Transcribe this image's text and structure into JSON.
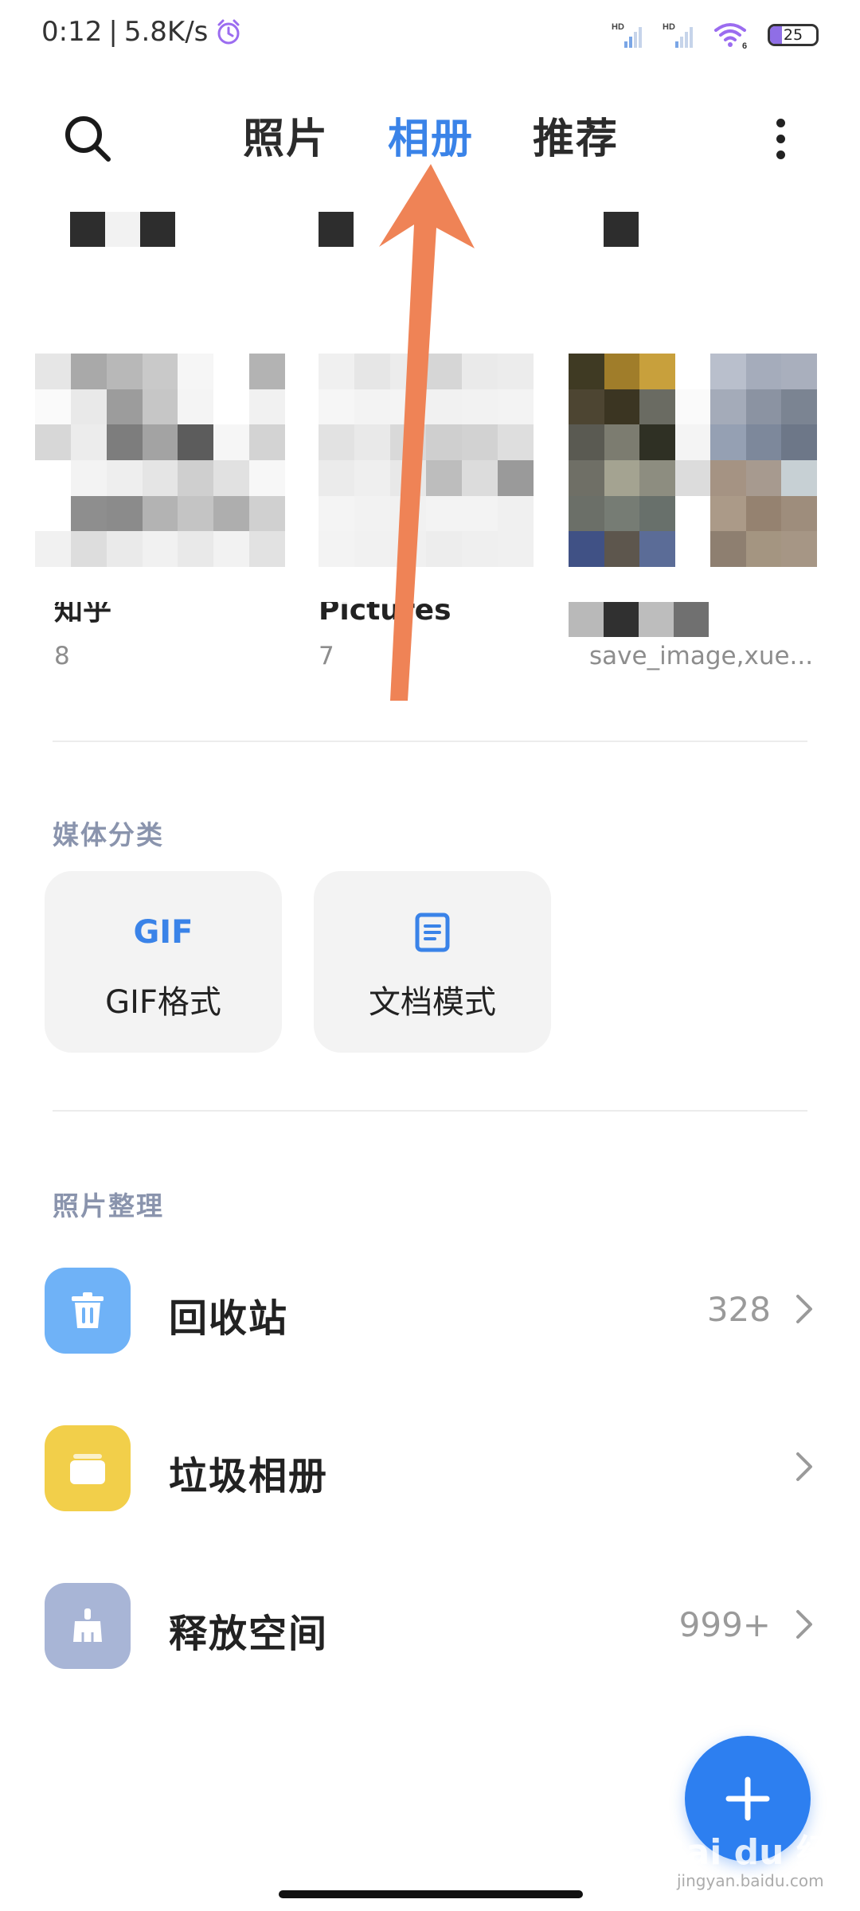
{
  "status_bar": {
    "time": "0:12",
    "separator": "|",
    "network_speed": "5.8K/s",
    "signal_1_label": "HD",
    "signal_2_label": "HD",
    "wifi_label": "6",
    "battery": "25",
    "battery_level": 0.25
  },
  "nav": {
    "tabs": [
      {
        "label": "照片",
        "active": false
      },
      {
        "label": "相册",
        "active": true
      },
      {
        "label": "推荐",
        "active": false
      }
    ]
  },
  "albums": [
    {
      "name": "知乎",
      "count": "8"
    },
    {
      "name": "Pictures",
      "count": "7"
    },
    {
      "name": "",
      "count": "save_image,xue..."
    }
  ],
  "media_categories": {
    "title": "媒体分类",
    "items": [
      {
        "icon_text": "GIF",
        "label": "GIF格式"
      },
      {
        "icon_text": "",
        "label": "文档模式"
      }
    ]
  },
  "organize": {
    "title": "照片整理",
    "items": [
      {
        "label": "回收站",
        "count": "328",
        "color": "#6fb2f7",
        "icon": "trash-icon"
      },
      {
        "label": "垃圾相册",
        "count": "",
        "color": "#f2cf4a",
        "icon": "junk-album-icon"
      },
      {
        "label": "释放空间",
        "count": "999+",
        "color": "#a8b5d6",
        "icon": "broom-icon"
      }
    ]
  },
  "watermark": {
    "brand": "Bai du 经验",
    "url": "jingyan.baidu.com"
  },
  "colors": {
    "accent": "#3a83e8",
    "fab": "#2d7ff0",
    "annotation_arrow": "#ef8356"
  }
}
